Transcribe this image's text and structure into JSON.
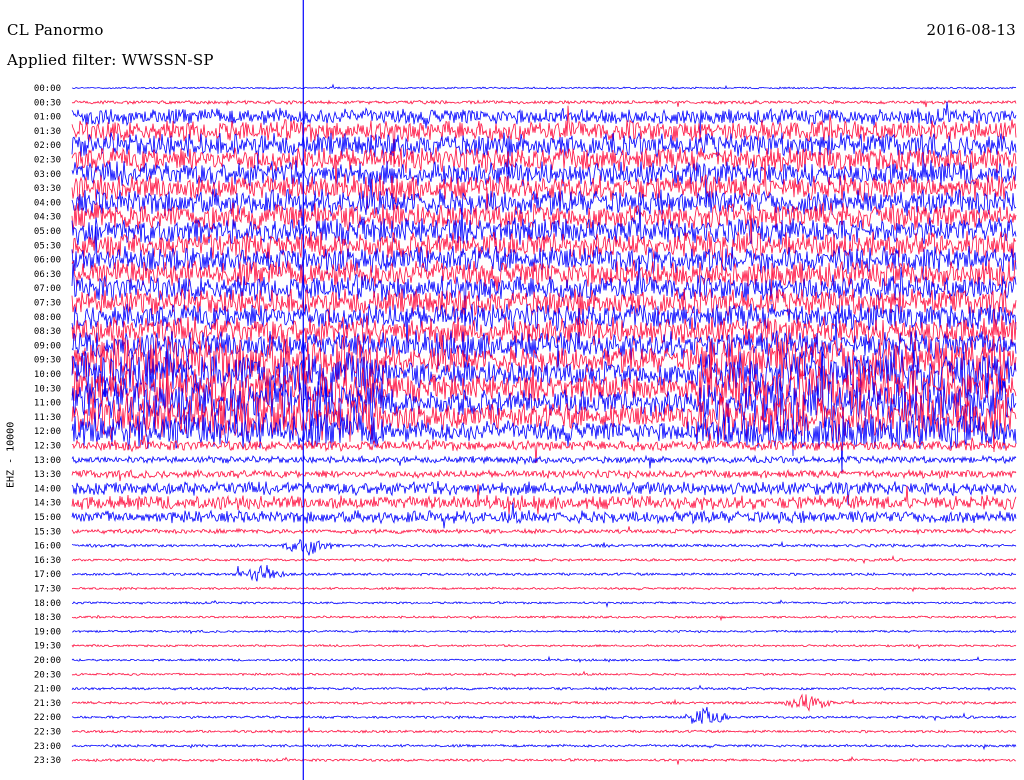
{
  "header": {
    "station": "CL Panormo",
    "date": "2016-08-13",
    "filter": "Applied filter: WWSSN-SP"
  },
  "channel_label": "EHZ - 10000",
  "colors": {
    "odd_trace": "#0000ff",
    "even_trace": "#ff1040",
    "marker_line": "#0000ff",
    "background": "#ffffff"
  },
  "chart_data": {
    "type": "line",
    "title": "CL Panormo",
    "subtitle": "Applied filter: WWSSN-SP",
    "date": "2016-08-13",
    "ylabel": "EHZ - 10000",
    "xlabel": "",
    "row_labels": [
      "00:00",
      "00:30",
      "01:00",
      "01:30",
      "02:00",
      "02:30",
      "03:00",
      "03:30",
      "04:00",
      "04:30",
      "05:00",
      "05:30",
      "06:00",
      "06:30",
      "07:00",
      "07:30",
      "08:00",
      "08:30",
      "09:00",
      "09:30",
      "10:00",
      "10:30",
      "11:00",
      "11:30",
      "12:00",
      "12:30",
      "13:00",
      "13:30",
      "14:00",
      "14:30",
      "15:00",
      "15:30",
      "16:00",
      "16:30",
      "17:00",
      "17:30",
      "18:00",
      "18:30",
      "19:00",
      "19:30",
      "20:00",
      "20:30",
      "21:00",
      "21:30",
      "22:00",
      "22:30",
      "23:00",
      "23:30"
    ],
    "row_minutes": 30,
    "trace_colors_alternate": [
      "blue",
      "red"
    ],
    "relative_amplitude_by_row": [
      0.2,
      0.4,
      1.8,
      2.5,
      2.7,
      2.8,
      2.8,
      2.9,
      2.9,
      3.0,
      3.0,
      3.0,
      3.0,
      3.0,
      3.0,
      3.0,
      3.0,
      3.2,
      3.2,
      3.3,
      3.3,
      3.3,
      3.3,
      3.3,
      2.6,
      1.2,
      0.8,
      0.9,
      1.5,
      1.6,
      1.4,
      0.5,
      0.35,
      0.3,
      0.3,
      0.25,
      0.25,
      0.25,
      0.25,
      0.25,
      0.25,
      0.25,
      0.3,
      0.3,
      0.3,
      0.3,
      0.3,
      0.3
    ],
    "notable_events": [
      {
        "time_fraction": 0.245,
        "note": "vertical marker line across all rows"
      },
      {
        "row": "16:00",
        "time_fraction": 0.25,
        "note": "burst"
      },
      {
        "row": "17:00",
        "time_fraction": 0.2,
        "note": "burst"
      },
      {
        "row": "21:30",
        "time_fraction": 0.78,
        "note": "burst"
      },
      {
        "row": "22:00",
        "time_fraction": 0.67,
        "note": "burst"
      }
    ],
    "grid": false
  }
}
